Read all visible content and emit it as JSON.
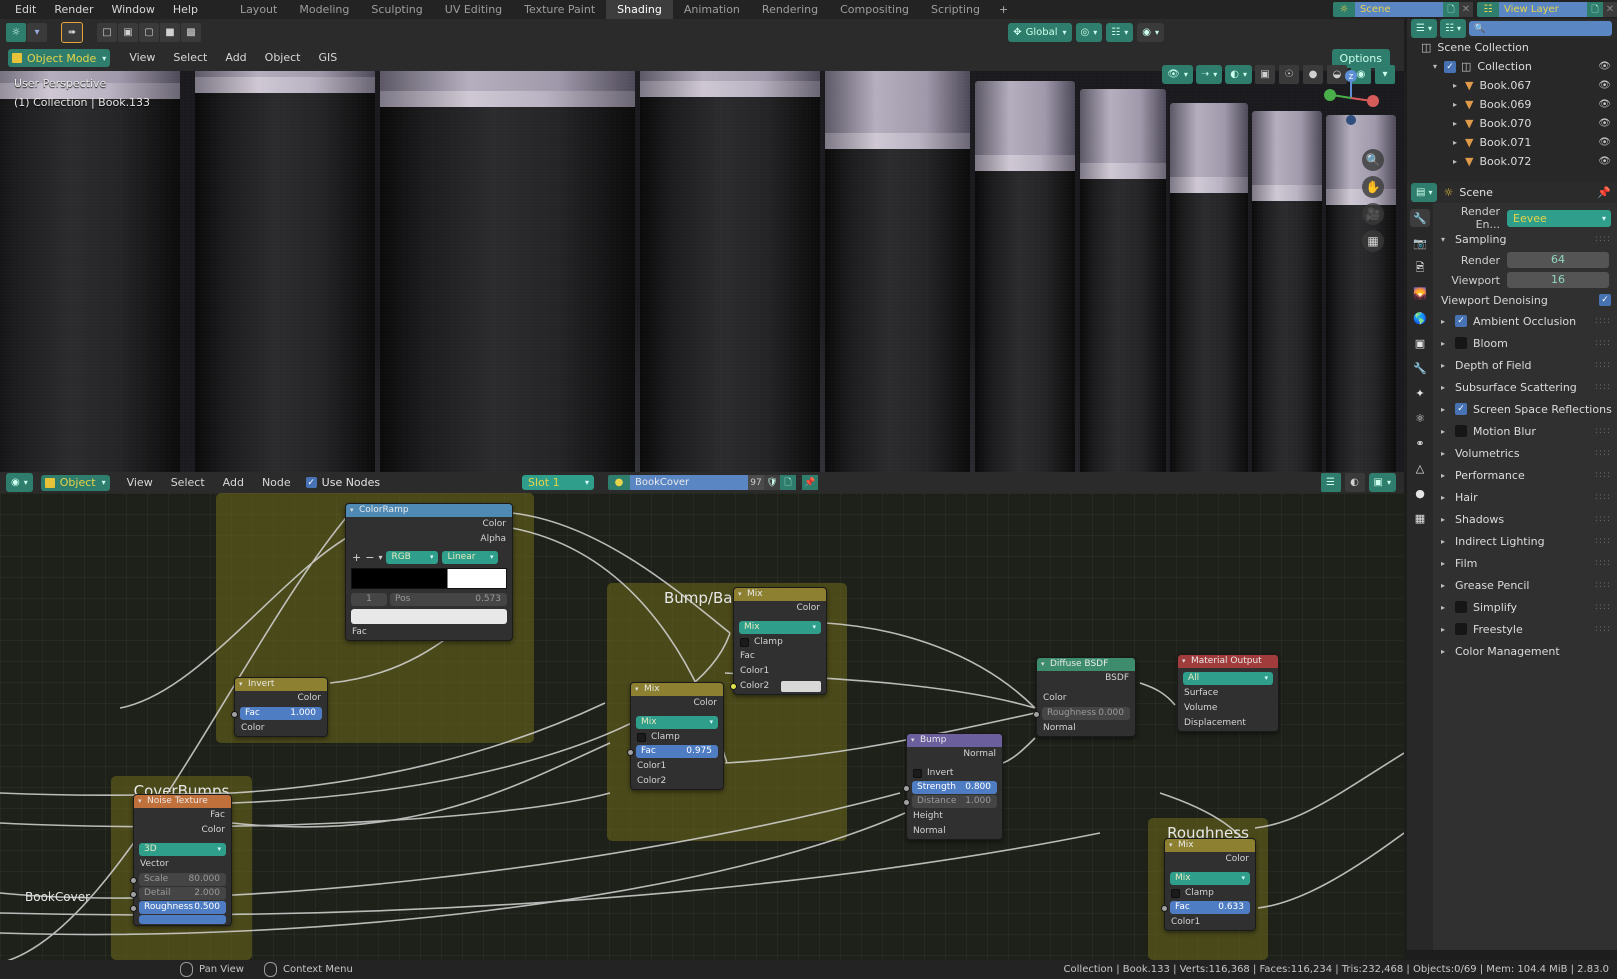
{
  "topbar": {
    "menus": [
      "Edit",
      "Render",
      "Window",
      "Help"
    ],
    "workspaces": [
      {
        "label": "Layout",
        "active": false
      },
      {
        "label": "Modeling",
        "active": false
      },
      {
        "label": "Sculpting",
        "active": false
      },
      {
        "label": "UV Editing",
        "active": false
      },
      {
        "label": "Texture Paint",
        "active": false
      },
      {
        "label": "Shading",
        "active": true
      },
      {
        "label": "Animation",
        "active": false
      },
      {
        "label": "Rendering",
        "active": false
      },
      {
        "label": "Compositing",
        "active": false
      },
      {
        "label": "Scripting",
        "active": false
      }
    ],
    "add_workspace": "+",
    "scene_name": "Scene",
    "view_layer_name": "View Layer"
  },
  "viewport": {
    "mode": "Object Mode",
    "menus": [
      "View",
      "Select",
      "Add",
      "Object",
      "GIS"
    ],
    "overlay_text_1": "User Perspective",
    "overlay_text_2": "(1) Collection | Book.133",
    "transform_orientation": "Global",
    "options_label": "Options"
  },
  "shader_editor": {
    "menus": [
      "View",
      "Select",
      "Add",
      "Node"
    ],
    "use_nodes_label": "Use Nodes",
    "use_nodes_checked": true,
    "slot_label": "Slot 1",
    "material_name": "BookCover",
    "material_users": "97"
  },
  "nodes": {
    "frames": [
      {
        "label": "Bump/Bands Mix"
      },
      {
        "label": "CoverBumps"
      },
      {
        "label": "Roughness"
      }
    ],
    "colorramp": {
      "title": "ColorRamp",
      "outputs": [
        "Color",
        "Alpha"
      ],
      "inputs": [
        "Fac"
      ],
      "add_btn": "+",
      "remove_btn": "−",
      "interp_color": "RGB",
      "interp_mode": "Linear",
      "pos_label": "Pos",
      "pos_value": "0.573",
      "index_value": "1"
    },
    "invert": {
      "title": "Invert",
      "output": "Color",
      "fac_label": "Fac",
      "fac_value": "1.000",
      "color_input": "Color"
    },
    "mix_top": {
      "title": "Mix",
      "output": "Color",
      "blend_mode": "Mix",
      "clamp_label": "Clamp",
      "inputs": [
        "Fac",
        "Color1",
        "Color2"
      ]
    },
    "mix_bottom": {
      "title": "Mix",
      "output": "Color",
      "blend_mode": "Mix",
      "clamp_label": "Clamp",
      "fac_label": "Fac",
      "fac_value": "0.975",
      "inputs": [
        "Color1",
        "Color2"
      ]
    },
    "noise_texture": {
      "title": "Noise Texture",
      "outputs": [
        "Fac",
        "Color"
      ],
      "dimension": "3D",
      "vector_label": "Vector",
      "scale_label": "Scale",
      "scale_value": "80.000",
      "detail_label": "Detail",
      "detail_value": "2.000",
      "roughness_label": "Roughness",
      "roughness_value": "0.500"
    },
    "bump": {
      "title": "Bump",
      "output": "Normal",
      "invert_label": "Invert",
      "strength_label": "Strength",
      "strength_value": "0.800",
      "distance_label": "Distance",
      "distance_value": "1.000",
      "height_label": "Height",
      "normal_label": "Normal"
    },
    "diffuse": {
      "title": "Diffuse BSDF",
      "output": "BSDF",
      "color_label": "Color",
      "roughness_label": "Roughness",
      "roughness_value": "0.000",
      "normal_label": "Normal"
    },
    "material_output": {
      "title": "Material Output",
      "target": "All",
      "inputs": [
        "Surface",
        "Volume",
        "Displacement"
      ]
    },
    "mix_roughness": {
      "title": "Mix",
      "output": "Color",
      "blend_mode": "Mix",
      "clamp_label": "Clamp",
      "fac_label": "Fac",
      "fac_value": "0.633",
      "color1_label": "Color1"
    },
    "bookcover_label": "BookCover"
  },
  "outliner": {
    "root": "Scene Collection",
    "collection": "Collection",
    "items": [
      {
        "label": "Book.067"
      },
      {
        "label": "Book.069"
      },
      {
        "label": "Book.070"
      },
      {
        "label": "Book.071"
      },
      {
        "label": "Book.072"
      }
    ]
  },
  "properties": {
    "scene_name": "Scene",
    "engine_label": "Render En...",
    "engine_value": "Eevee",
    "sampling": {
      "title": "Sampling",
      "render_label": "Render",
      "render_value": "64",
      "viewport_label": "Viewport",
      "viewport_value": "16",
      "denoise_label": "Viewport Denoising",
      "denoise_checked": true
    },
    "sections": [
      {
        "label": "Ambient Occlusion",
        "checkbox": true,
        "checked": true
      },
      {
        "label": "Bloom",
        "checkbox": true,
        "checked": false
      },
      {
        "label": "Depth of Field",
        "checkbox": false
      },
      {
        "label": "Subsurface Scattering",
        "checkbox": false
      },
      {
        "label": "Screen Space Reflections",
        "checkbox": true,
        "checked": true
      },
      {
        "label": "Motion Blur",
        "checkbox": true,
        "checked": false
      },
      {
        "label": "Volumetrics",
        "checkbox": false
      },
      {
        "label": "Performance",
        "checkbox": false
      },
      {
        "label": "Hair",
        "checkbox": false
      },
      {
        "label": "Shadows",
        "checkbox": false
      },
      {
        "label": "Indirect Lighting",
        "checkbox": false
      },
      {
        "label": "Film",
        "checkbox": false
      },
      {
        "label": "Grease Pencil",
        "checkbox": false
      },
      {
        "label": "Simplify",
        "checkbox": true,
        "checked": false
      },
      {
        "label": "Freestyle",
        "checkbox": true,
        "checked": false
      },
      {
        "label": "Color Management",
        "checkbox": false
      }
    ]
  },
  "statusbar": {
    "pan_view": "Pan View",
    "context_menu": "Context Menu",
    "stats": "Collection | Book.133 | Verts:116,368 | Faces:116,234 | Tris:232,468 | Objects:0/69 | Mem: 104.4 MiB | 2.83.0"
  },
  "colors": {
    "teal": "#2f9e8a",
    "blue": "#4f7dc4",
    "frame_yellow": "#837b1d",
    "node_header_mix": "#8d8031",
    "node_header_bump": "#6b5f9e",
    "node_header_output": "#a03c3c",
    "node_header_shader": "#3d8c6e",
    "node_header_tex": "#c0703a",
    "node_header_ramp": "#4f8ab5"
  }
}
